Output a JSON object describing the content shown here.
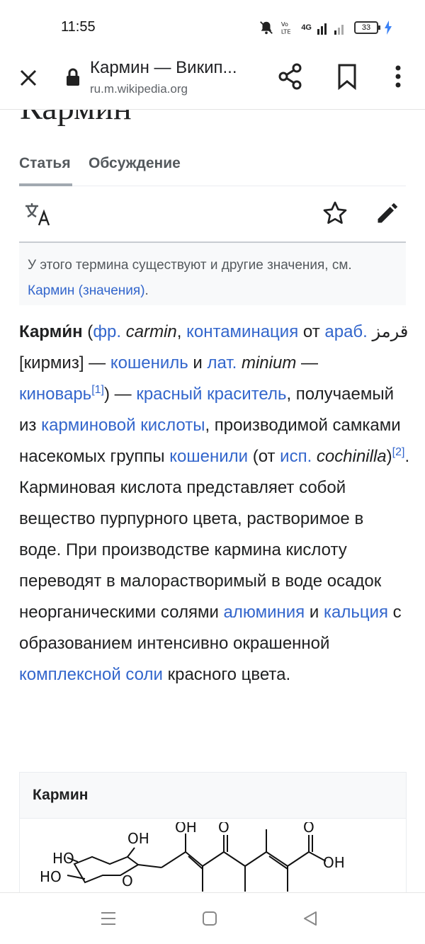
{
  "status_bar": {
    "time": "11:55",
    "battery": "33",
    "network": "4G"
  },
  "browser": {
    "page_title": "Кармин — Википедия",
    "title_display": "Кармин — Викип...",
    "url": "ru.m.wikipedia.org"
  },
  "article": {
    "title": "Кармин",
    "tabs": [
      {
        "label": "Статья"
      },
      {
        "label": "Обсуждение"
      }
    ],
    "hatnote": {
      "text": "У этого термина существуют и другие значения, см. ",
      "link": "Кармин (значения)",
      "tail": "."
    },
    "lead": {
      "bold_term": "Карми́н",
      "t1": " (",
      "l_fr": "фр.",
      "i_carmin": " carmin",
      "t2": ", ",
      "l_contamination": "контаминация",
      "t3": " от ",
      "l_arab": "араб.",
      "arabic": " قرمز",
      "t4": " [кирмиз] — ",
      "l_koshenil": "кошениль",
      "t5": " и ",
      "l_lat": "лат.",
      "i_minium": " minium",
      "t6": " — ",
      "l_kinovar": "киноварь",
      "ref1": "[1]",
      "t7": ") — ",
      "l_krasitel": "красный краситель",
      "t8": ", получаемый из ",
      "l_acid": "карминовой кислоты",
      "t9": ", производимой самками насекомых группы ",
      "l_kosheniil": "кошенили",
      "t10": " (от ",
      "l_isp": "исп.",
      "i_cochinilla": " cochinilla",
      "t11": ")",
      "ref2": "[2]",
      "t12": ". Карминовая кислота представляет собой вещество пурпурного цвета, растворимое в воде. При производстве кармина кислоту переводят в малорастворимый в воде осадок неорганическими солями ",
      "l_aluminium": "алюминия",
      "t13": " и ",
      "l_calcium": "кальция",
      "t14": " с образованием интенсивно окрашенной ",
      "l_complex": "комплексной соли",
      "t15": " красного цвета."
    },
    "infobox": {
      "title": "Кармин",
      "structure_labels": {
        "oh1": "OH",
        "o1": "O",
        "o2": "O",
        "oh2": "OH",
        "ho1": "HO",
        "ho2": "HO",
        "o3": "O",
        "oh3": "OH"
      }
    }
  },
  "colors": {
    "link": "#3366cc",
    "text": "#202122",
    "muted": "#54595d"
  },
  "icons": [
    "close-icon",
    "lock-icon",
    "share-icon",
    "bookmark-icon",
    "more-vert-icon",
    "translate-icon",
    "star-icon",
    "edit-pencil-icon",
    "menu-icon",
    "home-square-icon",
    "back-triangle-icon"
  ]
}
